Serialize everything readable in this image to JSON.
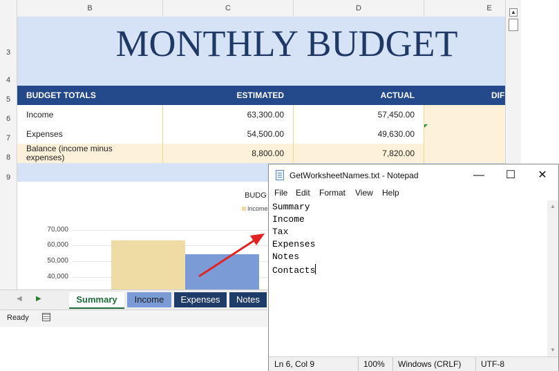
{
  "excel": {
    "columns": [
      "B",
      "C",
      "D",
      "E"
    ],
    "rows": [
      "3",
      "4",
      "5",
      "6",
      "7",
      "8",
      "9"
    ],
    "title": "MONTHLY BUDGET",
    "table": {
      "headers": [
        "BUDGET TOTALS",
        "ESTIMATED",
        "ACTUAL",
        "DIF"
      ],
      "rows": [
        {
          "label": "Income",
          "estimated": "63,300.00",
          "actual": "57,450.00"
        },
        {
          "label": "Expenses",
          "estimated": "54,500.00",
          "actual": "49,630.00"
        },
        {
          "label": "Balance (income minus expenses)",
          "estimated": "8,800.00",
          "actual": "7,820.00"
        }
      ]
    },
    "tabs": [
      "Summary",
      "Income",
      "Expenses",
      "Notes"
    ],
    "status": "Ready",
    "colors": {
      "header_blue": "#24498a",
      "band": "#d6e2f6",
      "cream": "#fdf1d9",
      "accent_green": "#1d6b3a"
    }
  },
  "chart_data": {
    "type": "bar",
    "title": "BUDG",
    "legend": [
      "Income"
    ],
    "yticks": [
      "70,000",
      "60,000",
      "50,000",
      "40,000"
    ],
    "series": [
      {
        "name": "Income",
        "color": "#efdba4",
        "values": [
          63300
        ]
      },
      {
        "color": "#7b9bd7",
        "values": [
          54500
        ]
      }
    ],
    "ylim": [
      36000,
      70000
    ],
    "grid": true
  },
  "notepad": {
    "title": "GetWorksheetNames.txt - Notepad",
    "menu": [
      "File",
      "Edit",
      "Format",
      "View",
      "Help"
    ],
    "lines": [
      "Summary",
      "Income",
      "Tax",
      "Expenses",
      "Notes",
      "Contacts"
    ],
    "status": {
      "position": "Ln 6, Col 9",
      "zoom": "100%",
      "eol": "Windows (CRLF)",
      "encoding": "UTF-8"
    },
    "window_buttons": {
      "minimize": "—",
      "maximize": "☐",
      "close": "✕"
    }
  }
}
